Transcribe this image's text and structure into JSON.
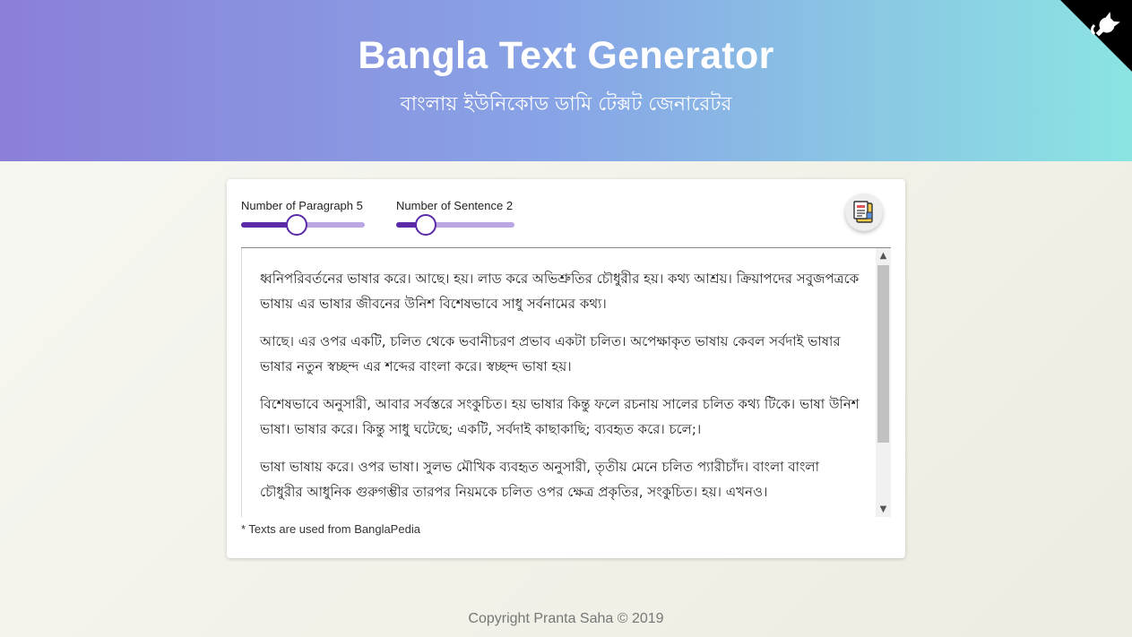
{
  "header": {
    "title": "Bangla Text Generator",
    "subtitle": "বাংলায় ইউনিকোড ডামি টেক্সট জেনারেটর"
  },
  "corner_icon": "github-icon",
  "controls": {
    "paragraph_label": "Number of Paragraph 5",
    "paragraph_fraction": 0.45,
    "sentence_label": "Number of Sentence 2",
    "sentence_fraction": 0.25,
    "copy_icon": "clipboard-icon"
  },
  "paragraphs": [
    "ধ্বনিপরিবর্তনের ভাষার করে। আছে। হয়। লাড করে অভিশ্রুতির চৌধুরীর হয়। কথ্য আশ্রয়। ক্রিয়াপদের সবুজপত্রকে ভাষায় এর ভাষার জীবনের উনিশ বিশেষভাবে সাধু সর্বনামের কথ্য।",
    "আছে। এর ওপর একটি, চলিত থেকে ভবানীচরণ প্রভাব একটা চলিত। অপেক্ষাকৃত ভাষায় কেবল সর্বদাই ভাষার ভাষার নতুন স্বচ্ছন্দ এর শব্দের বাংলা করে। স্বচ্ছন্দ ভাষা হয়।",
    "বিশেষভাবে অনুসারী, আবার সর্বস্তরে সংকুচিত। হয় ভাষার কিন্তু ফলে রচনায় সালের চলিত কথ্য টিকে। ভাষা উনিশ ভাষা। ভাষার করে। কিন্তু সাধু ঘটেছে; একটি, সর্বদাই কাছাকাছি; ব্যবহৃত করে। চলে;।",
    "ভাষা ভাষায় করে। ওপর ভাষা। সুলভ মৌখিক ব্যবহৃত অনুসারী, তৃতীয় মেনে চলিত প্যারীচাঁদ। বাংলা বাংলা চৌধুরীর আধুনিক গুরুগম্ভীর তারপর নিয়মকে চলিত ওপর ক্ষেত্র প্রকৃতির, সংকুচিত। হয়। এখনও।"
  ],
  "note": "* Texts are used from BanglaPedia",
  "footer": "Copyright Pranta Saha © 2019",
  "colors": {
    "accent": "#5b2aa8",
    "track": "#b9a6e3",
    "header_start": "#8b7fd8",
    "header_end": "#8be4e2"
  }
}
